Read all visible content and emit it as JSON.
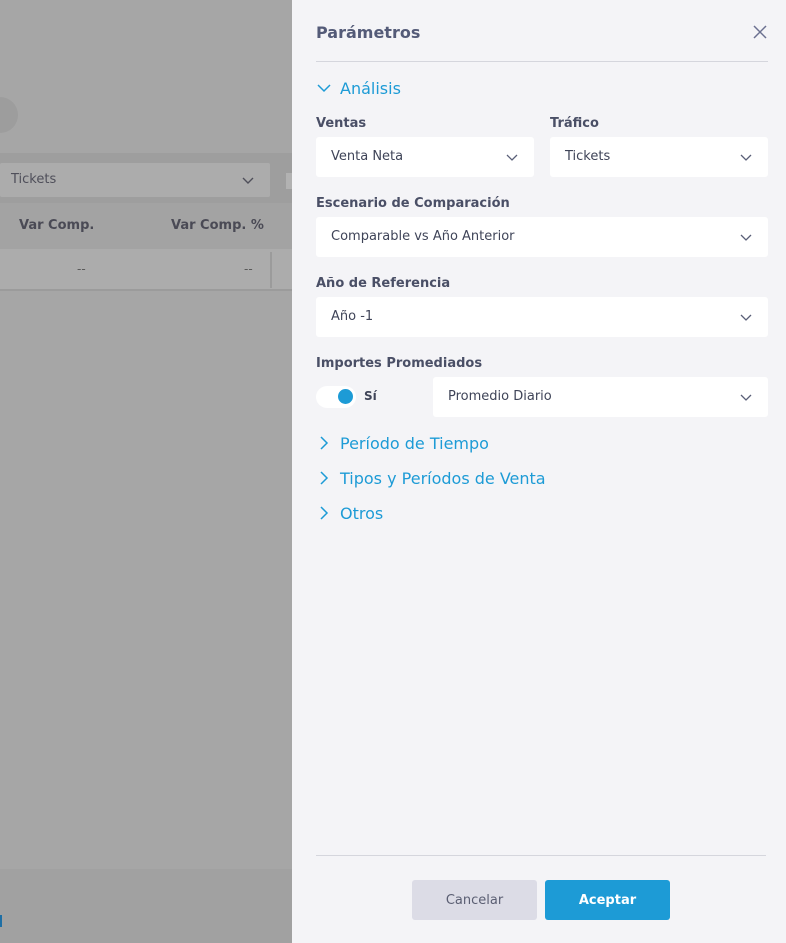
{
  "background": {
    "select_label": "Tickets",
    "table_headers": [
      "Var Comp.",
      "Var Comp. %"
    ],
    "row_values": [
      "--",
      "--"
    ]
  },
  "panel": {
    "title": "Parámetros",
    "close_icon": "close-icon",
    "sections": {
      "analisis": {
        "label": "Análisis",
        "expanded": true
      },
      "periodo_tiempo": {
        "label": "Período de Tiempo",
        "expanded": false
      },
      "tipos_periodos": {
        "label": "Tipos y Períodos de Venta",
        "expanded": false
      },
      "otros": {
        "label": "Otros",
        "expanded": false
      }
    },
    "fields": {
      "ventas": {
        "label": "Ventas",
        "value": "Venta Neta"
      },
      "trafico": {
        "label": "Tráfico",
        "value": "Tickets"
      },
      "escenario": {
        "label": "Escenario de Comparación",
        "value": "Comparable vs Año Anterior"
      },
      "anio_referencia": {
        "label": "Año de Referencia",
        "value": "Año -1"
      },
      "importes_promediados": {
        "label": "Importes Promediados",
        "toggle_on": true,
        "toggle_label": "Sí",
        "value": "Promedio Diario"
      }
    },
    "buttons": {
      "cancel": "Cancelar",
      "accept": "Aceptar"
    }
  },
  "colors": {
    "accent": "#1d9bd6",
    "panel_bg": "#f4f4f7",
    "overlay": "#a6a6a6",
    "cancel_bg": "#dcdce6"
  }
}
